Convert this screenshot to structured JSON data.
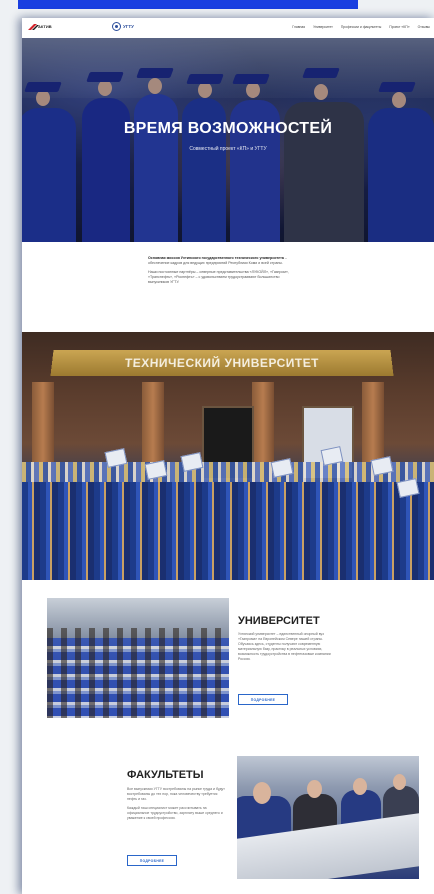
{
  "navbar": {
    "logo_word": "АКТИВ",
    "center_logo_text": "УГТУ",
    "links": [
      "Главная",
      "Университет",
      "Профессии и факультеты",
      "Проект «КП»",
      "Отзывы"
    ]
  },
  "hero": {
    "title": "ВРЕМЯ ВОЗМОЖНОСТЕЙ",
    "subtitle": "Совместный проект «КП» и УГТУ"
  },
  "mission": {
    "p1_bold": "Основная миссия Ухтинского государственного технического университета",
    "p1_rest": " – обеспечение кадров для ведущих предприятий Республики Коми и всей страны.",
    "p2": "Наши постоянные партнёры – северные представительства «ЛУКОЙЛ», «Газпром», «Транснефть», «Роснефть» – с удовольствием трудоустраивают большинство выпускников УГТУ."
  },
  "photo2": {
    "sign_text": "ТЕХНИЧЕСКИЙ УНИВЕРСИТЕТ"
  },
  "university": {
    "title": "УНИВЕРСИТЕТ",
    "text": "Ухтинский университет – единственный опорный вуз «Газпрома» на Европейском Севере нашей страны. Обучаясь здесь, студенты получают современную материальную базу, практику в реальных условиях, возможность трудоустройства в нефтегазовые компании России.",
    "button": "ПОДРОБНЕЕ"
  },
  "faculties": {
    "title": "ФАКУЛЬТЕТЫ",
    "p1": "Все выпускники УГТУ востребованы на рынке труда и будут востребованы до тех пор, пока человечеству требуется нефть и газ.",
    "p2": "Каждый наш специалист может рассчитывать на официальное трудоустройство, зарплату выше среднего и уважение к своей профессии.",
    "button": "ПОДРОБНЕЕ"
  },
  "colors": {
    "accent": "#2a66c9",
    "top_link": "#1a3fe0",
    "brand_blue": "#2d4f9c"
  }
}
